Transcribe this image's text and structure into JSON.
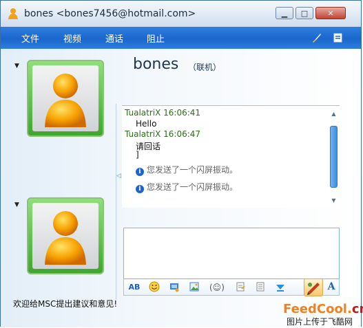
{
  "window": {
    "title": "bones <bones7456@hotmail.com>",
    "buttons": {
      "minimize": "▁",
      "maximize": "□",
      "close": "✕"
    }
  },
  "menu": {
    "items": [
      "文件",
      "视频",
      "通话",
      "阻止"
    ],
    "icons": [
      "brush-icon",
      "window-icon"
    ]
  },
  "contact": {
    "name": "bones",
    "status": "（联机）"
  },
  "history": {
    "messages": [
      {
        "sender": "TualatriX 16:06:41",
        "lines": [
          "Hello"
        ]
      },
      {
        "sender": "TualatriX 16:06:47",
        "lines": [
          "请回话",
          "]"
        ]
      }
    ],
    "notices": [
      "您发送了一个闪屏振动。",
      "您发送了一个闪屏振动。"
    ]
  },
  "toolbar": {
    "tools": [
      "spell-check-icon",
      "emoticon-icon",
      "voice-clip-icon",
      "picture-icon",
      "nudge-icon",
      "wink-icon",
      "background-icon",
      "download-icon"
    ],
    "send_icon": "send-icon",
    "font_label": "A"
  },
  "statusbar": {
    "text": "欢迎给MSC提出建议和意见!"
  },
  "watermark": {
    "brand_a": "FeedCool.",
    "brand_b": "cn",
    "tagline": "图片上传于飞酷网"
  },
  "colors": {
    "menubar": "#1b66cc",
    "sender": "#2f6d1e",
    "avatar_frame": "#3fa62c",
    "accent": "#f08020"
  }
}
